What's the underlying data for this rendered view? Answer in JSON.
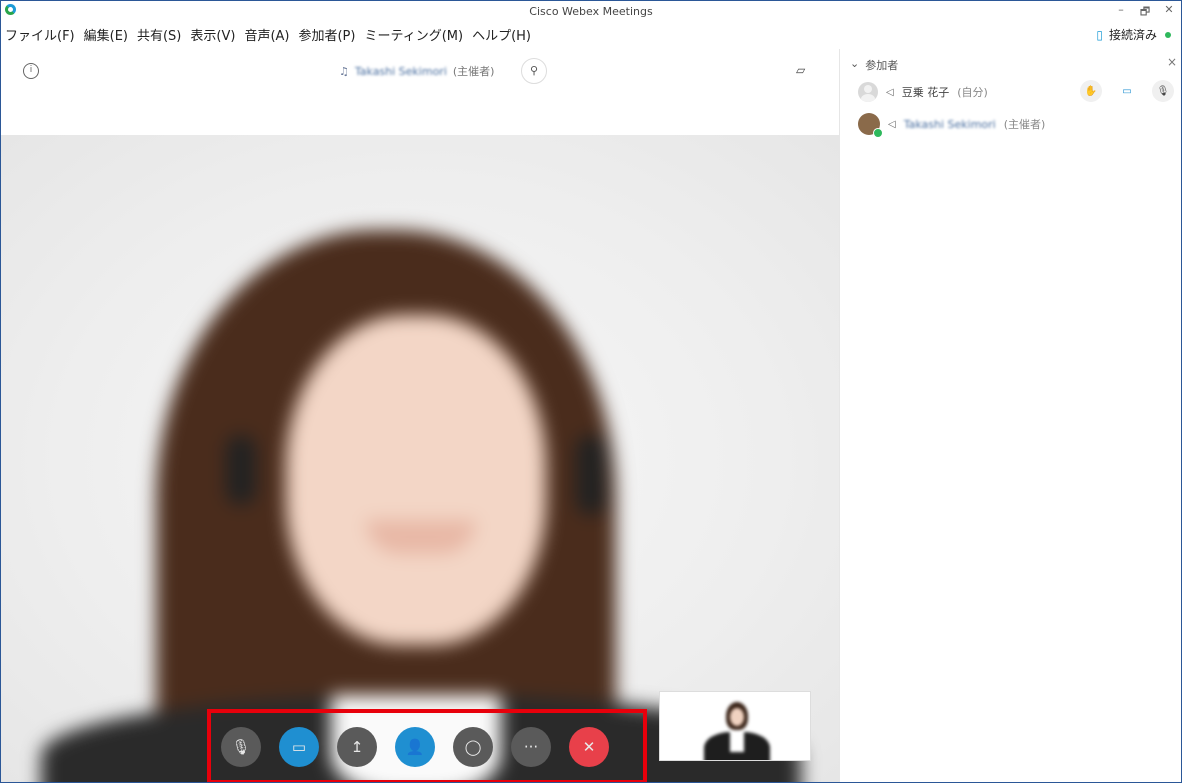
{
  "window": {
    "title": "Cisco Webex Meetings",
    "controls": [
      "–",
      "🗗",
      "✕"
    ]
  },
  "menu": [
    "ファイル(F)",
    "編集(E)",
    "共有(S)",
    "表示(V)",
    "音声(A)",
    "参加者(P)",
    "ミーティング(M)",
    "ヘルプ(H)"
  ],
  "status": {
    "label": "接続済み"
  },
  "stage": {
    "active_speaker_name": "Takashi Sekimori",
    "active_speaker_role": "(主催者)"
  },
  "controls": {
    "mute": "🎙",
    "video": "▭",
    "share": "↥",
    "participants": "👤",
    "chat": "◯",
    "more": "···",
    "leave": "✕"
  },
  "panel": {
    "header": "参加者",
    "close": "×",
    "participants": [
      {
        "name": "豆乗 花子",
        "role": "(自分)"
      },
      {
        "name": "Takashi Sekimori",
        "role": "(主催者)"
      }
    ],
    "row_actions": {
      "raise_hand": "✋",
      "video": "▭",
      "mute": "🎙"
    }
  },
  "colors": {
    "accent_blue": "#1f8fd1",
    "leave_red": "#e8404a",
    "highlight_red": "#e8000b",
    "connected_green": "#2eb85c"
  },
  "icons": {
    "app": "webex-logo-icon",
    "info": "info-icon",
    "pin": "pin-icon",
    "layout": "layout-icon"
  }
}
